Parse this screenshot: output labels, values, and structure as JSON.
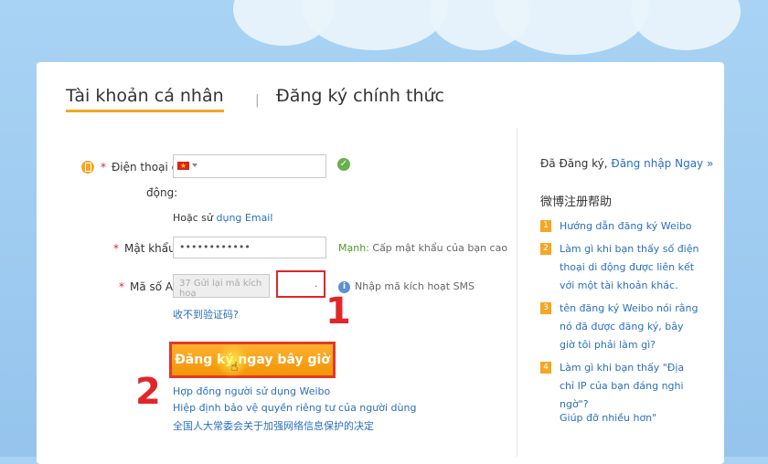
{
  "tabs": {
    "personal": "Tài khoản cá nhân",
    "separator": "|",
    "official": "Đăng ký chính thức"
  },
  "form": {
    "phone_label": "Điện thoại di",
    "phone_label_cont": "động:",
    "country_flag_symbol": "★",
    "email_prefix": "Hoặc sử ",
    "email_link": "dụng Email",
    "password_label": "Mật khẩu:",
    "password_value": "••••••••••••",
    "strength_label": "Mạnh: ",
    "strength_text": "Cấp mật khẩu của bạn cao",
    "code_label": "Mã số A",
    "code_placeholder": "37 Gửi lại mã kích hoạ",
    "code_input_value": ".",
    "code_hint": "Nhập mã kích hoạt SMS",
    "code_not_received": "收不到验证码?",
    "register_button": "Đăng ký ngay bây giờ",
    "link_agreement": "Hợp đồng người sử dụng Weibo",
    "link_privacy": "Hiệp định bảo vệ quyền riêng tư của người dùng",
    "link_decision": "全国人大常委会关于加强网络信息保护的决定"
  },
  "annotations": {
    "one": "1",
    "two": "2"
  },
  "sidebar": {
    "registered_text": "Đã Đăng ký, ",
    "login_link": "Đăng nhập Ngay »",
    "help_heading": "微博注册帮助",
    "help_items": [
      {
        "num": "1",
        "text": "Hướng dẫn đăng ký Weibo"
      },
      {
        "num": "2",
        "text": "Làm gì khi bạn thấy số điện thoại di động được liên kết với một tài khoản khác."
      },
      {
        "num": "3",
        "text": "tên đăng ký Weibo nói rằng nó đã được đăng ký, bây giờ tôi phải làm gì?"
      },
      {
        "num": "4",
        "text": "Làm gì khi bạn thấy \"Địa chỉ IP của bạn đáng nghi ngờ\"?"
      }
    ],
    "more_help": "Giúp đỡ nhiều hơn\""
  },
  "colors": {
    "accent": "#f5a623",
    "link": "#2a6fc0",
    "annotation": "#e0262a"
  },
  "icons": [
    "phone-icon",
    "check-icon",
    "info-icon",
    "chevron-down-icon",
    "cursor-hand-icon"
  ]
}
